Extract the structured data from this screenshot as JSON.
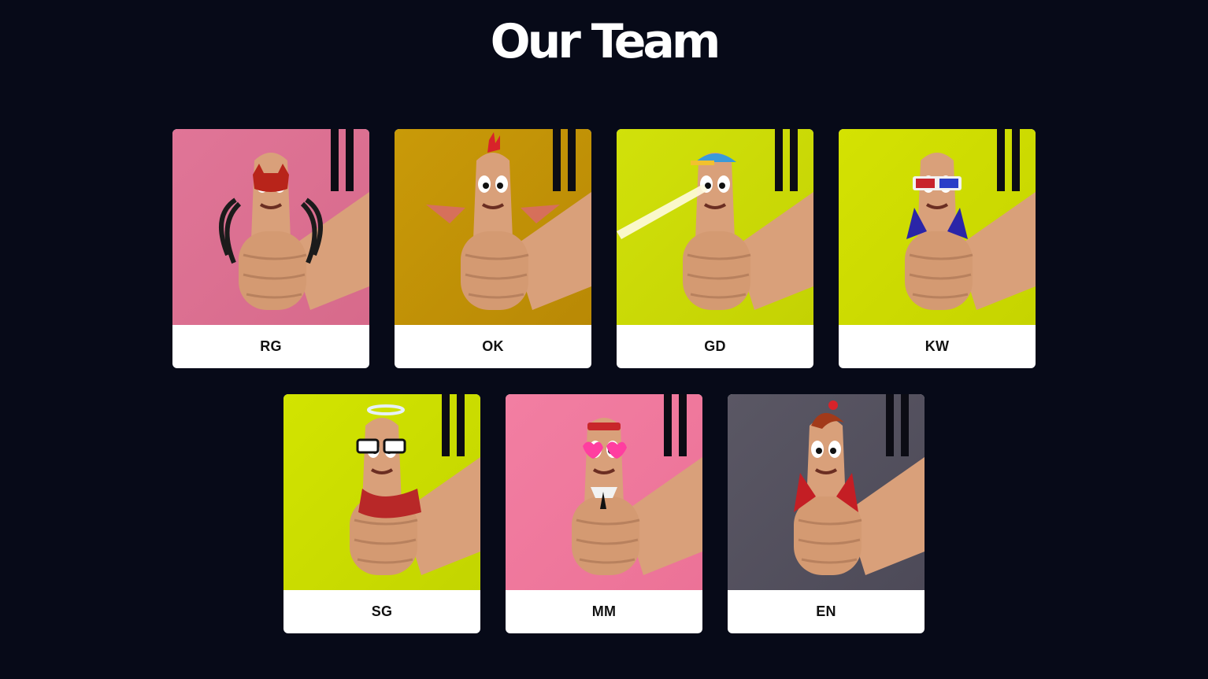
{
  "page": {
    "title": "Our Team",
    "background": "#070a18"
  },
  "members": [
    {
      "name": "RG",
      "bg": "#e07597",
      "bg2": "#d76a8b",
      "avatar": "thumbs-up-devil-mask-wings-avatar",
      "accessory": "devil-mask"
    },
    {
      "name": "OK",
      "bg": "#c99a08",
      "bg2": "#b98905",
      "avatar": "thumbs-up-mohawk-bat-wings-avatar",
      "accessory": "mohawk"
    },
    {
      "name": "GD",
      "bg": "#d1e10a",
      "bg2": "#c4d203",
      "avatar": "thumbs-up-cap-laser-eye-avatar",
      "accessory": "cap"
    },
    {
      "name": "KW",
      "bg": "#d4e202",
      "bg2": "#c6d400",
      "avatar": "thumbs-up-3d-glasses-cape-avatar",
      "accessory": "3d-glasses"
    },
    {
      "name": "SG",
      "bg": "#d2e400",
      "bg2": "#c3d500",
      "avatar": "thumbs-up-halo-glasses-scarf-avatar",
      "accessory": "halo"
    },
    {
      "name": "MM",
      "bg": "#f27ea2",
      "bg2": "#ec7297",
      "avatar": "thumbs-up-heart-glasses-tie-avatar",
      "accessory": "heart-glasses"
    },
    {
      "name": "EN",
      "bg": "#5a5764",
      "bg2": "#4d4a58",
      "avatar": "thumbs-up-vampire-cape-avatar",
      "accessory": "vampire-hair"
    }
  ]
}
